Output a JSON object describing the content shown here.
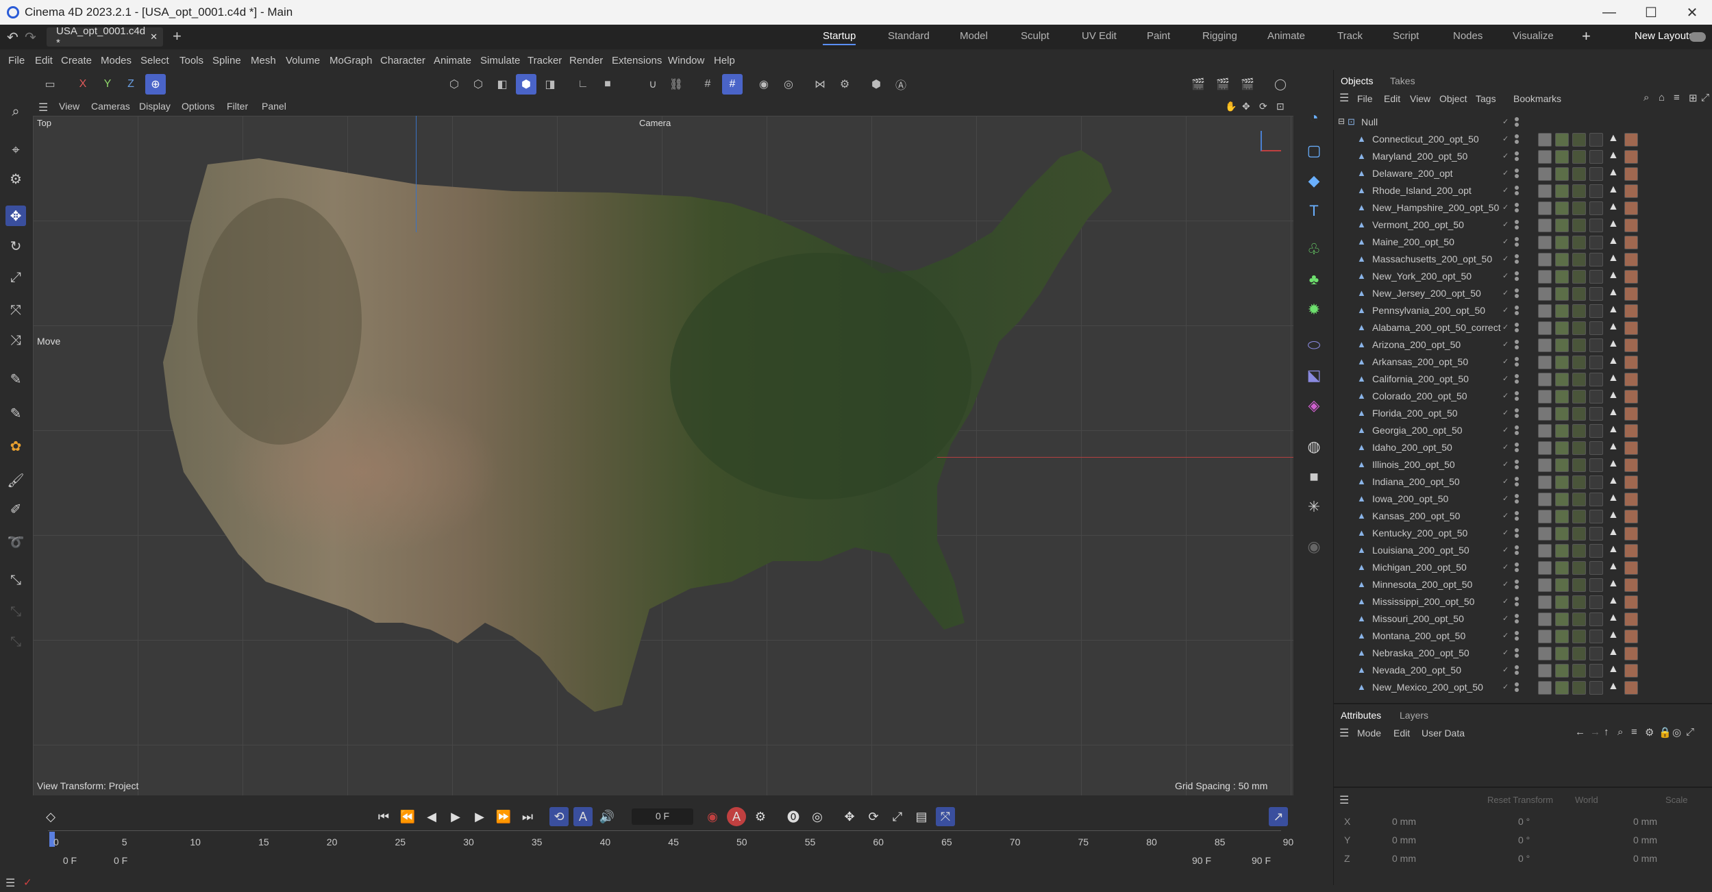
{
  "app": {
    "title": "Cinema 4D 2023.2.1 - [USA_opt_0001.c4d *] - Main"
  },
  "doc_tab": {
    "name": "USA_opt_0001.c4d *",
    "close": "✕",
    "add": "+"
  },
  "layouts": [
    "Startup",
    "Standard",
    "Model",
    "Sculpt",
    "UV Edit",
    "Paint",
    "Rigging",
    "Animate",
    "Track",
    "Script",
    "Nodes",
    "Visualize"
  ],
  "layouts_active": "Startup",
  "new_layouts": "New Layouts",
  "menu": [
    "File",
    "Edit",
    "Create",
    "Modes",
    "Select",
    "Tools",
    "Spline",
    "Mesh",
    "Volume",
    "MoGraph",
    "Character",
    "Animate",
    "Simulate",
    "Tracker",
    "Render",
    "Extensions",
    "Window",
    "Help"
  ],
  "axis_buttons": {
    "x": "X",
    "y": "Y",
    "z": "Z"
  },
  "viewport": {
    "menu": [
      "View",
      "Cameras",
      "Display",
      "Options",
      "Filter",
      "Panel"
    ],
    "view_name": "Top",
    "camera": "Camera",
    "move_label": "Move",
    "transform": "View Transform: Project",
    "grid": "Grid Spacing : 50 mm"
  },
  "objects_panel": {
    "tabs": [
      "Objects",
      "Takes"
    ],
    "menu": [
      "File",
      "Edit",
      "View",
      "Object",
      "Tags",
      "Bookmarks"
    ],
    "root": "Null",
    "items": [
      "Connecticut_200_opt_50",
      "Maryland_200_opt_50",
      "Delaware_200_opt",
      "Rhode_Island_200_opt",
      "New_Hampshire_200_opt_50",
      "Vermont_200_opt_50",
      "Maine_200_opt_50",
      "Massachusetts_200_opt_50",
      "New_York_200_opt_50",
      "New_Jersey_200_opt_50",
      "Pennsylvania_200_opt_50",
      "Alabama_200_opt_50_correct",
      "Arizona_200_opt_50",
      "Arkansas_200_opt_50",
      "California_200_opt_50",
      "Colorado_200_opt_50",
      "Florida_200_opt_50",
      "Georgia_200_opt_50",
      "Idaho_200_opt_50",
      "Illinois_200_opt_50",
      "Indiana_200_opt_50",
      "Iowa_200_opt_50",
      "Kansas_200_opt_50",
      "Kentucky_200_opt_50",
      "Louisiana_200_opt_50",
      "Michigan_200_opt_50",
      "Minnesota_200_opt_50",
      "Mississippi_200_opt_50",
      "Missouri_200_opt_50",
      "Montana_200_opt_50",
      "Nebraska_200_opt_50",
      "Nevada_200_opt_50",
      "New_Mexico_200_opt_50"
    ]
  },
  "attributes": {
    "tabs": [
      "Attributes",
      "Layers"
    ],
    "menu": [
      "Mode",
      "Edit",
      "User Data"
    ],
    "reset": "Reset Transform",
    "space": "World",
    "scale": "Scale",
    "rows": [
      {
        "axis": "X",
        "pos": "0 mm",
        "rot": "0 °",
        "scale": "0 mm"
      },
      {
        "axis": "Y",
        "pos": "0 mm",
        "rot": "0 °",
        "scale": "0 mm"
      },
      {
        "axis": "Z",
        "pos": "0 mm",
        "rot": "0 °",
        "scale": "0 mm"
      }
    ]
  },
  "timeline": {
    "current_frame": "0 F",
    "ticks": [
      "0",
      "5",
      "10",
      "15",
      "20",
      "25",
      "30",
      "35",
      "40",
      "45",
      "50",
      "55",
      "60",
      "65",
      "70",
      "75",
      "80",
      "85",
      "90"
    ],
    "start": "0 F",
    "start2": "0 F",
    "end": "90 F",
    "end2": "90 F"
  }
}
